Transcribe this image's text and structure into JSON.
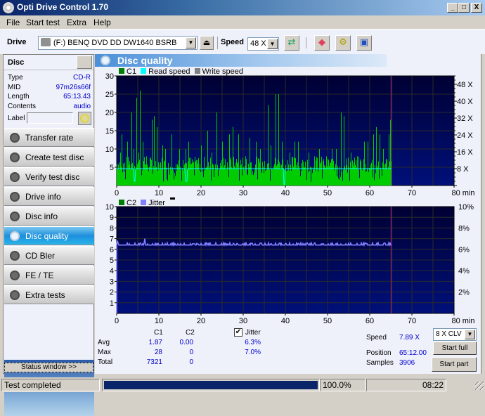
{
  "window": {
    "title": "Opti Drive Control 1.70",
    "min_label": "_",
    "max_label": "□",
    "close_label": "X"
  },
  "menu": [
    {
      "label": "File"
    },
    {
      "label": "Start test"
    },
    {
      "label": "Extra"
    },
    {
      "label": "Help"
    }
  ],
  "toolbar": {
    "drive_label": "Drive",
    "drive_value": "(F:)   BENQ DVD DD DW1640 BSRB",
    "speed_label": "Speed",
    "speed_value": "48 X",
    "icons": [
      "eject-icon",
      "refresh-icon",
      "erase-icon",
      "settings-icon",
      "save-icon"
    ]
  },
  "disc": {
    "header": "Disc",
    "rows": [
      {
        "label": "Type",
        "value": "CD-R"
      },
      {
        "label": "MID",
        "value": "97m26s66f"
      },
      {
        "label": "Length",
        "value": "65:13.43"
      },
      {
        "label": "Contents",
        "value": "audio"
      }
    ],
    "label_field": "Label",
    "label_value": ""
  },
  "nav": [
    {
      "label": "Transfer rate",
      "active": false
    },
    {
      "label": "Create test disc",
      "active": false
    },
    {
      "label": "Verify test disc",
      "active": false
    },
    {
      "label": "Drive info",
      "active": false
    },
    {
      "label": "Disc info",
      "active": false
    },
    {
      "label": "Disc quality",
      "active": true
    },
    {
      "label": "CD Bler",
      "active": false
    },
    {
      "label": "FE / TE",
      "active": false
    },
    {
      "label": "Extra tests",
      "active": false
    }
  ],
  "status_window_button": "Status window >>",
  "section_title": "Disc quality",
  "colors": {
    "c1": "#00cc00",
    "read_speed": "#00ffff",
    "write_speed": "#808080",
    "c2": "#008000",
    "jitter": "#8080ff",
    "marker": "#a0208f",
    "plot_bg_top": "#000033",
    "plot_bg_bottom": "#00107a"
  },
  "chart_data": [
    {
      "type": "bar",
      "title": "C1 / Read speed",
      "legend": [
        "C1",
        "Read speed",
        "Write speed"
      ],
      "legend_position": "top-left",
      "xlabel": "min",
      "xlim": [
        0,
        80
      ],
      "x_ticks": [
        "0",
        "10",
        "20",
        "30",
        "40",
        "50",
        "60",
        "70",
        "80 min"
      ],
      "ylim": [
        0,
        30
      ],
      "y_ticks": [
        "5",
        "10",
        "15",
        "20",
        "25",
        "30"
      ],
      "y2lim": [
        0,
        52
      ],
      "y2_ticks": [
        "8 X",
        "16 X",
        "24 X",
        "32 X",
        "40 X",
        "48 X"
      ],
      "grid": true,
      "marker_x": 65.2,
      "series": [
        {
          "name": "C1",
          "note": "per-sample error counts, end at 65.2 min",
          "peaks": [
            [
              0.8,
              9
            ],
            [
              1.2,
              14
            ],
            [
              2.5,
              12
            ],
            [
              3.5,
              20
            ],
            [
              4.0,
              10
            ],
            [
              4.7,
              24
            ],
            [
              5.2,
              9
            ],
            [
              5.5,
              26
            ],
            [
              6.1,
              12
            ],
            [
              7.0,
              8
            ],
            [
              8.3,
              18
            ],
            [
              8.8,
              19
            ],
            [
              9.5,
              16
            ],
            [
              10.8,
              11
            ],
            [
              11.5,
              10
            ],
            [
              13.0,
              14
            ],
            [
              14.8,
              10
            ],
            [
              15.6,
              7
            ],
            [
              16.3,
              10
            ],
            [
              17.0,
              12
            ],
            [
              19.2,
              7
            ],
            [
              20.0,
              11
            ],
            [
              21.5,
              15
            ],
            [
              22.5,
              9
            ],
            [
              23.6,
              20
            ],
            [
              25.0,
              12
            ],
            [
              26.7,
              14
            ],
            [
              27.5,
              16
            ],
            [
              28.8,
              14
            ],
            [
              30.5,
              8
            ],
            [
              31.5,
              13
            ],
            [
              33.0,
              12
            ],
            [
              34.0,
              10
            ],
            [
              35.8,
              22
            ],
            [
              36.5,
              11
            ],
            [
              37.6,
              25
            ],
            [
              38.3,
              25
            ],
            [
              39.2,
              12
            ],
            [
              41.0,
              9
            ],
            [
              42.2,
              12
            ],
            [
              43.0,
              12
            ],
            [
              44.0,
              7
            ],
            [
              45.5,
              9
            ],
            [
              46.8,
              8
            ],
            [
              48.0,
              10
            ],
            [
              49.6,
              8
            ],
            [
              51.0,
              10
            ],
            [
              52.0,
              10
            ],
            [
              53.2,
              20
            ],
            [
              53.9,
              19
            ],
            [
              55.5,
              9
            ],
            [
              57.0,
              8
            ],
            [
              58.6,
              12
            ],
            [
              59.5,
              12
            ],
            [
              60.8,
              14
            ],
            [
              61.5,
              16
            ],
            [
              62.4,
              14
            ],
            [
              63.1,
              10
            ],
            [
              64.5,
              14
            ],
            [
              64.9,
              18
            ]
          ],
          "base_level": 4
        },
        {
          "name": "Read speed",
          "units": "X",
          "level": 8,
          "dips": [
            [
              4.3,
              2
            ],
            [
              16.5,
              2
            ],
            [
              39.8,
              -1
            ]
          ],
          "end": 65.2
        }
      ]
    },
    {
      "type": "line",
      "title": "C2 / Jitter",
      "legend": [
        "C2",
        "Jitter"
      ],
      "legend_position": "top-left",
      "xlabel": "min",
      "xlim": [
        0,
        80
      ],
      "x_ticks": [
        "0",
        "10",
        "20",
        "30",
        "40",
        "50",
        "60",
        "70",
        "80 min"
      ],
      "ylim": [
        0,
        10
      ],
      "y_ticks": [
        "1",
        "2",
        "3",
        "4",
        "5",
        "6",
        "7",
        "8",
        "9",
        "10"
      ],
      "y2lim": [
        0,
        10
      ],
      "y2_ticks": [
        "2%",
        "4%",
        "6%",
        "8%",
        "10%"
      ],
      "grid": true,
      "marker_x": 65.2,
      "series": [
        {
          "name": "C2",
          "values_constant": 0
        },
        {
          "name": "Jitter",
          "units": "%",
          "baseline": 6.4,
          "spikes": [
            [
              0.2,
              6.8
            ],
            [
              6.6,
              7.0
            ],
            [
              12.0,
              6.6
            ],
            [
              13.5,
              6.6
            ],
            [
              21.3,
              6.6
            ],
            [
              23.5,
              6.6
            ],
            [
              26.8,
              6.6
            ],
            [
              34.1,
              6.6
            ],
            [
              36.0,
              6.6
            ],
            [
              41.0,
              6.6
            ],
            [
              47.0,
              6.6
            ],
            [
              58.5,
              6.6
            ],
            [
              62.0,
              6.6
            ],
            [
              64.5,
              6.6
            ]
          ],
          "end": 65.2
        }
      ]
    }
  ],
  "stats": {
    "col_c1": "C1",
    "col_c2": "C2",
    "rows": [
      {
        "label": "Avg",
        "c1": "1.87",
        "c2": "0.00",
        "jitter": "6.3%"
      },
      {
        "label": "Max",
        "c1": "28",
        "c2": "0",
        "jitter": "7.0%"
      },
      {
        "label": "Total",
        "c1": "7321",
        "c2": "0"
      }
    ],
    "jitter_label": "Jitter",
    "jitter_checked": true,
    "speed_label": "Speed",
    "speed_value": "7.89 X",
    "position_label": "Position",
    "position_value": "65:12.00",
    "samples_label": "Samples",
    "samples_value": "3906",
    "speed_select": "8 X CLV",
    "start_full": "Start full",
    "start_part": "Start part"
  },
  "statusbar": {
    "text": "Test completed",
    "progress": 1.0,
    "percent": "100.0%",
    "time": "08:22"
  }
}
